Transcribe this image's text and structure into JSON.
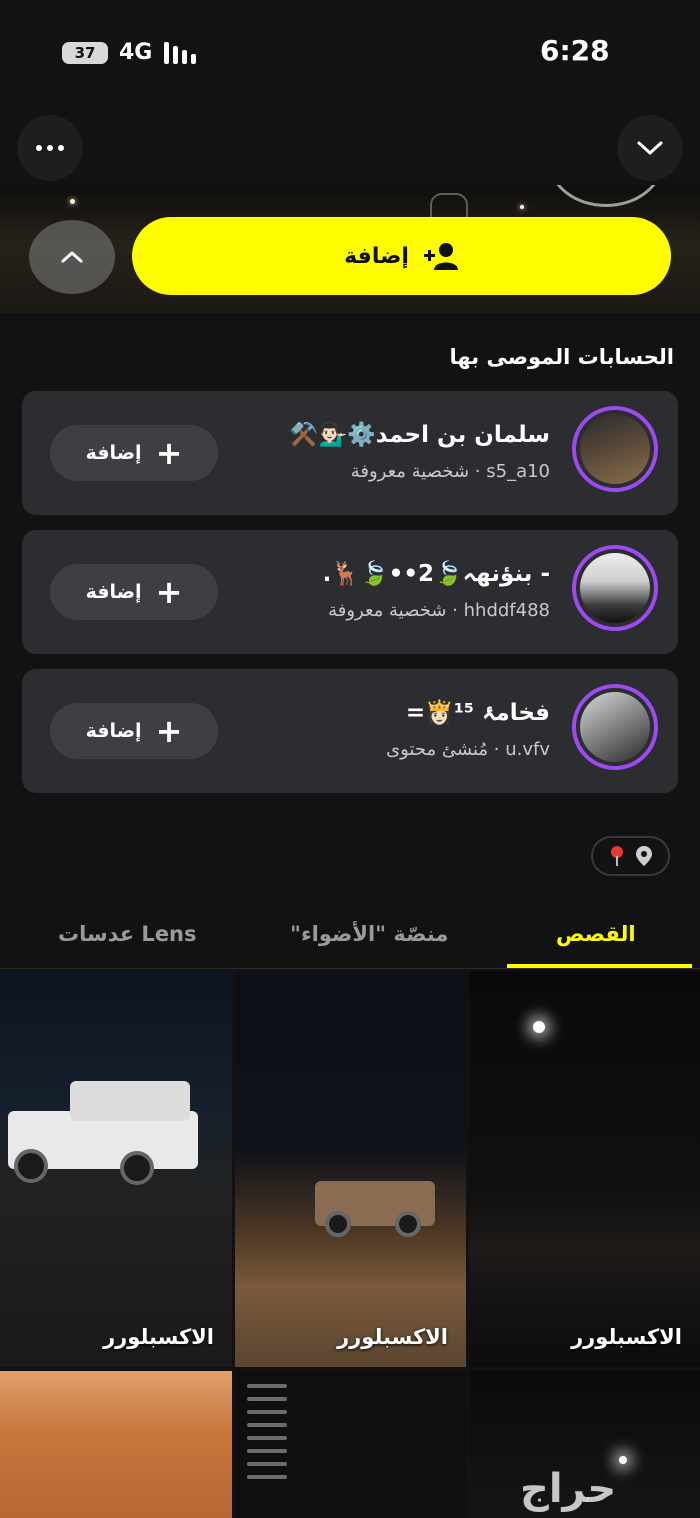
{
  "status_bar": {
    "battery": "37",
    "network": "4G",
    "time": "6:28"
  },
  "header": {
    "add_button_label": "إضافة"
  },
  "recommended": {
    "title": "الحسابات الموصى بها",
    "add_label": "إضافة",
    "accounts": [
      {
        "name": "سلمان بن احمد⚙️💁🏻‍♂️⚒️",
        "username": "s5_a10",
        "category": "شخصية معروفة"
      },
      {
        "name": "- بنؤنهہ🍃2••🍃🦌.",
        "username": "hhddf488",
        "category": "شخصية معروفة"
      },
      {
        "name": "فخامۂ ¹⁵👸🏻=",
        "username": "u.vfv",
        "category": "مُنشئ محتوى"
      }
    ]
  },
  "tabs": {
    "stories": "القصص",
    "spotlight": "منصّة \"الأضواء\"",
    "lenses": "عدسات Lens"
  },
  "grid": {
    "captions": [
      "الاكسبلورر",
      "الاكسبلورر",
      "الاكسبلورر"
    ]
  },
  "watermark": "حراج",
  "colors": {
    "accent": "#fffc00",
    "background": "#121212",
    "card": "#2b2d30",
    "avatar_ring": "#9c4bf1"
  }
}
